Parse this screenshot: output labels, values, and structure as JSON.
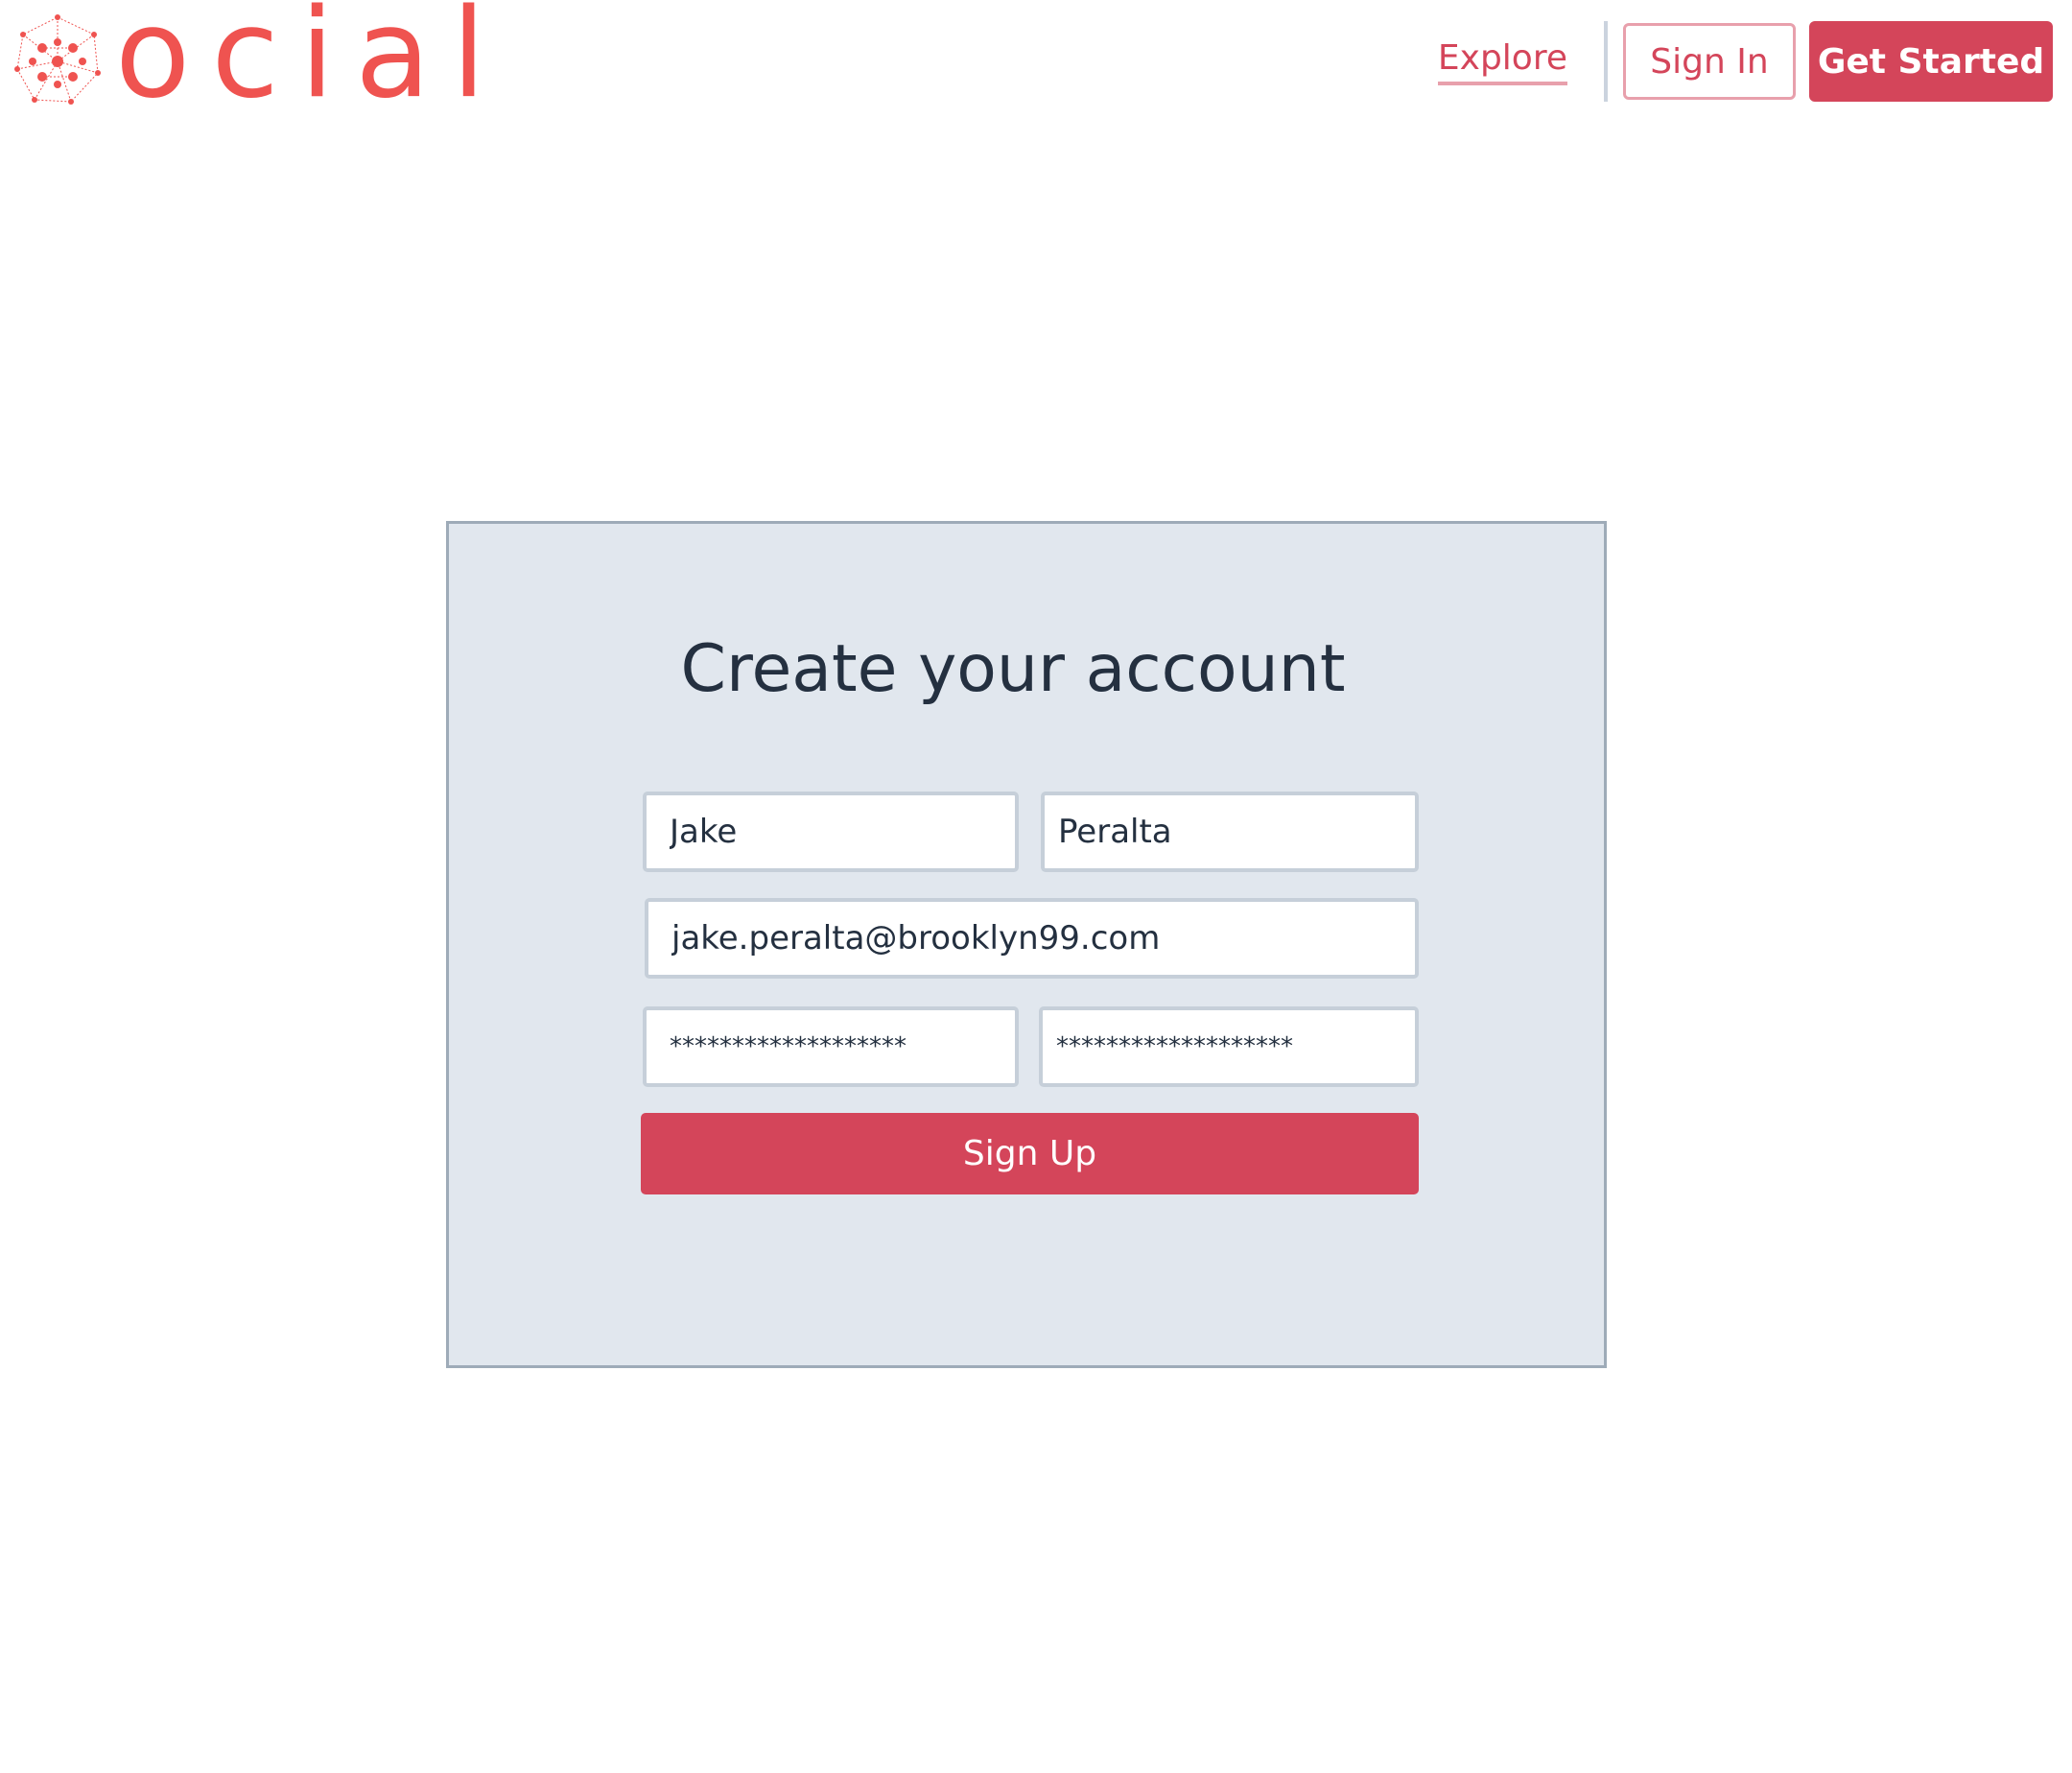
{
  "brand": {
    "wordmark": "ocial",
    "color": "#ef5350"
  },
  "nav": {
    "explore_label": "Explore",
    "signin_label": "Sign In",
    "get_started_label": "Get Started",
    "accent_color": "#d4455a"
  },
  "form": {
    "title": "Create your account",
    "first_name_value": "Jake",
    "last_name_value": "Peralta",
    "email_value": "jake.peralta@brooklyn99.com",
    "password_value": "*******************",
    "confirm_password_value": "*******************",
    "submit_label": "Sign Up"
  }
}
